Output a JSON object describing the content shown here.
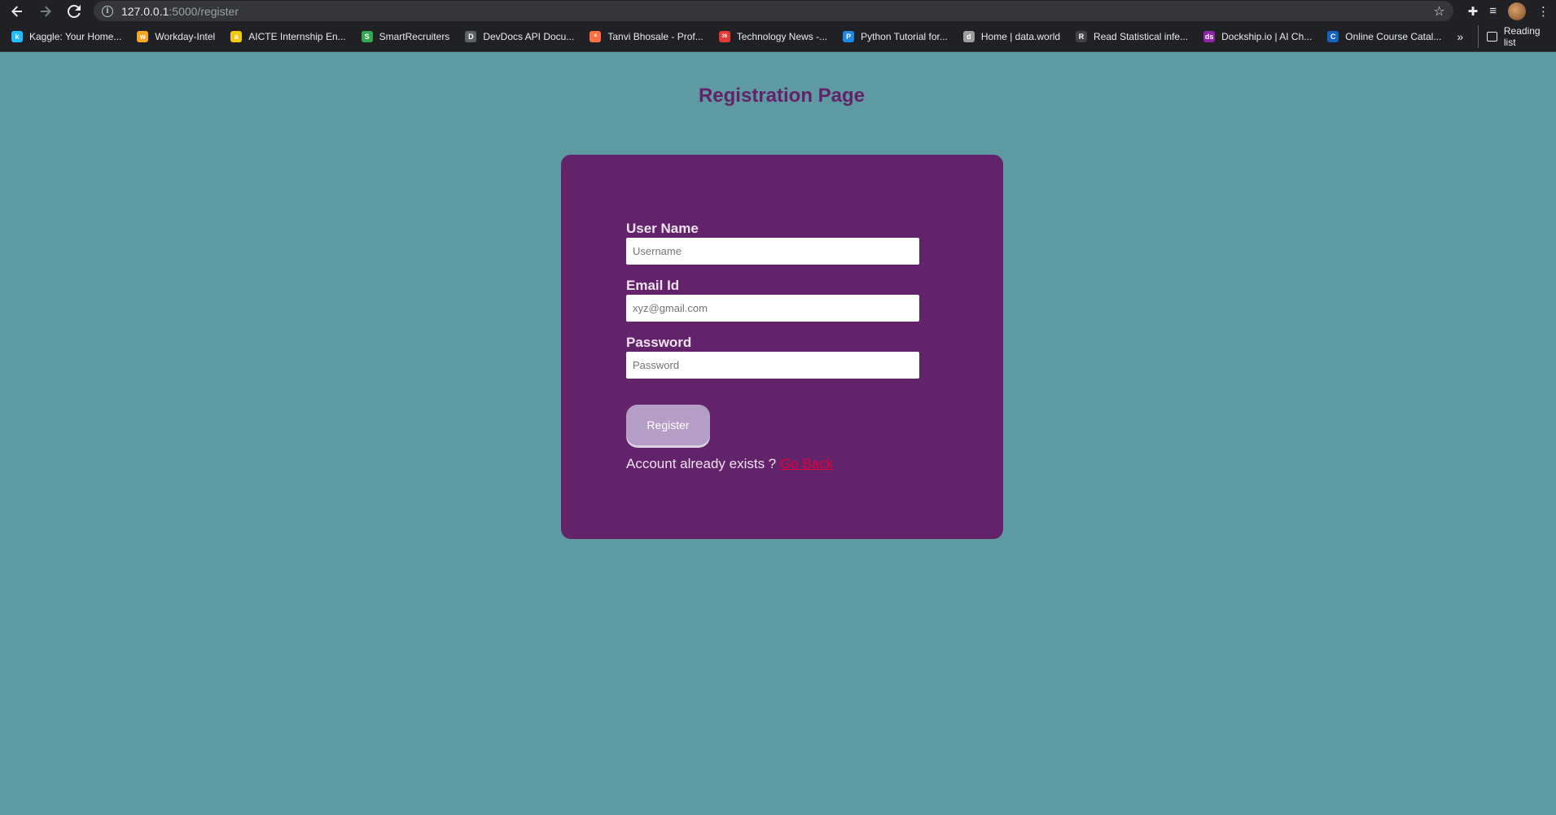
{
  "browser": {
    "url_host": "127.0.0.1",
    "url_path": ":5000/register",
    "bookmarks": [
      {
        "label": "Kaggle: Your Home...",
        "icon": "k",
        "color": "#20beff"
      },
      {
        "label": "Workday-Intel",
        "icon": "w",
        "color": "#f5a623"
      },
      {
        "label": "AICTE Internship En...",
        "icon": "a",
        "color": "#f2c811"
      },
      {
        "label": "SmartRecruiters",
        "icon": "S",
        "color": "#34a853"
      },
      {
        "label": "DevDocs API Docu...",
        "icon": "D",
        "color": "#5f6368"
      },
      {
        "label": "Tanvi Bhosale - Prof...",
        "icon": "*",
        "color": "#ff7043"
      },
      {
        "label": "Technology News -...",
        "icon": "360",
        "color": "#e53935"
      },
      {
        "label": "Python Tutorial for...",
        "icon": "P",
        "color": "#1e88e5"
      },
      {
        "label": "Home | data.world",
        "icon": "d",
        "color": "#9e9e9e"
      },
      {
        "label": "Read Statistical infe...",
        "icon": "R",
        "color": "#424242"
      },
      {
        "label": "Dockship.io | AI Ch...",
        "icon": "ds",
        "color": "#8e24aa"
      },
      {
        "label": "Online Course Catal...",
        "icon": "C",
        "color": "#1565c0"
      }
    ],
    "more_label": "»",
    "reading_list_label": "Reading list"
  },
  "page": {
    "title": "Registration Page"
  },
  "form": {
    "username": {
      "label": "User Name",
      "placeholder": "Username",
      "value": ""
    },
    "email": {
      "label": "Email Id",
      "placeholder": "xyz@gmail.com",
      "value": ""
    },
    "password": {
      "label": "Password",
      "placeholder": "Password",
      "value": ""
    },
    "register_label": "Register",
    "footer_text": "Account already exists ? ",
    "footer_link": "Go Back"
  },
  "colors": {
    "background": "#5e9aa1",
    "card": "#63236a",
    "title": "#63236a",
    "button": "#b59ec5",
    "link": "#e5003a"
  }
}
